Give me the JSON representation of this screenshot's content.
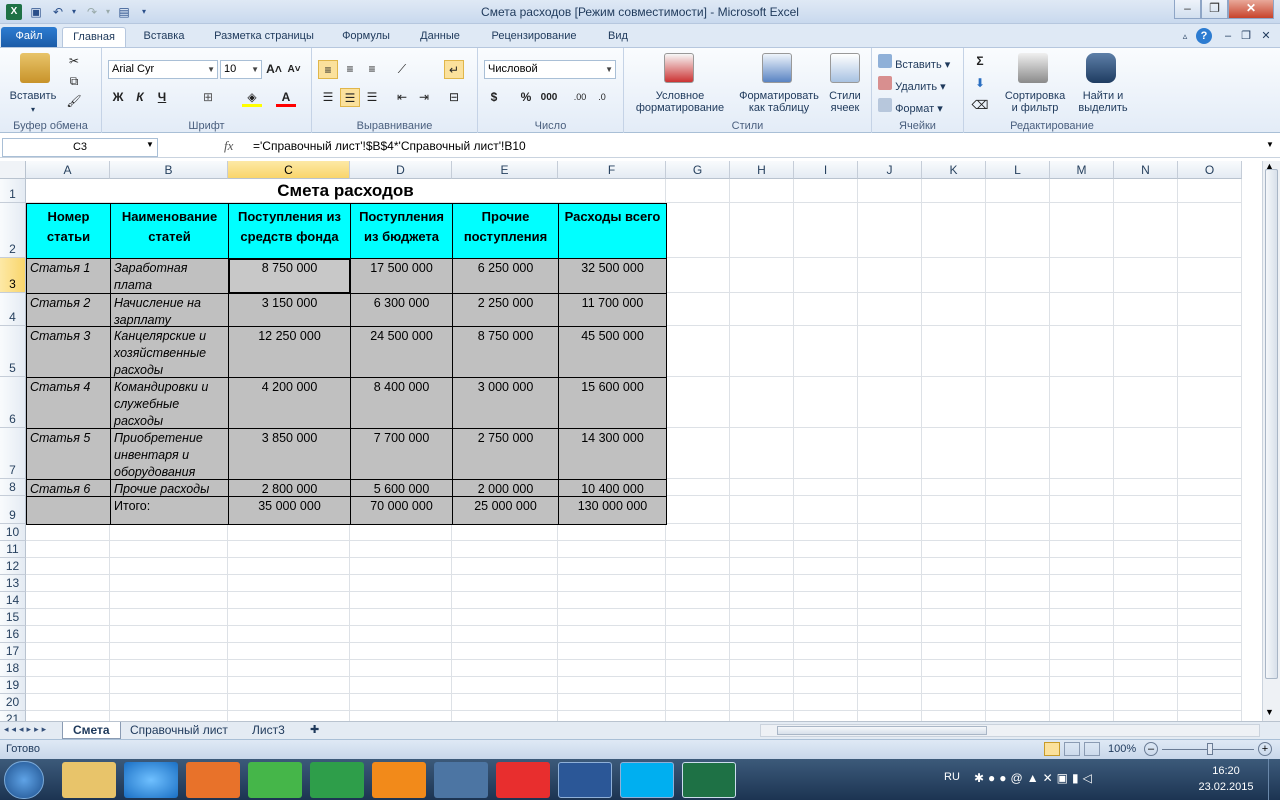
{
  "window": {
    "title": "Смета расходов  [Режим совместимости]  -  Microsoft Excel"
  },
  "tabs": [
    "Файл",
    "Главная",
    "Вставка",
    "Разметка страницы",
    "Формулы",
    "Данные",
    "Рецензирование",
    "Вид"
  ],
  "ribbon": {
    "groups": {
      "clipboard": "Буфер обмена",
      "font": "Шрифт",
      "alignment": "Выравнивание",
      "number": "Число",
      "styles": "Стили",
      "cells": "Ячейки",
      "editing": "Редактирование"
    },
    "paste_label": "Вставить",
    "font_name": "Arial Cyr",
    "font_size": "10",
    "bold": "Ж",
    "italic": "К",
    "underline": "Ч",
    "number_format": "Числовой",
    "currency": "$",
    "percent": "%",
    "thousands": "000",
    "cond_format_1": "Условное",
    "cond_format_2": "форматирование",
    "format_table_1": "Форматировать",
    "format_table_2": "как таблицу",
    "cell_styles_1": "Стили",
    "cell_styles_2": "ячеек",
    "insert": "Вставить",
    "delete": "Удалить",
    "format": "Формат",
    "sort_1": "Сортировка",
    "sort_2": "и фильтр",
    "find_1": "Найти и",
    "find_2": "выделить",
    "sigma": "Σ"
  },
  "formula_bar": {
    "name_box": "C3",
    "fx": "fx",
    "formula": "='Справочный лист'!$B$4*'Справочный лист'!B10"
  },
  "columns": [
    "A",
    "B",
    "C",
    "D",
    "E",
    "F",
    "G",
    "H",
    "I",
    "J",
    "K",
    "L",
    "M",
    "N",
    "O"
  ],
  "rows": [
    "1",
    "2",
    "3",
    "4",
    "5",
    "6",
    "7",
    "8",
    "9",
    "10",
    "11",
    "12",
    "13",
    "14",
    "15",
    "16",
    "17",
    "18",
    "19",
    "20",
    "21"
  ],
  "sheet": {
    "title": "Смета расходов",
    "headers": [
      "Номер статьи",
      "Наименование статей",
      "Поступления из средств фонда",
      "Поступления из бюджета",
      "Прочие поступления",
      "Расходы всего"
    ],
    "data": [
      [
        "Статья 1",
        "Заработная плата",
        "8 750 000",
        "17 500 000",
        "6 250 000",
        "32 500 000"
      ],
      [
        "Статья 2",
        "Начисление на зарплату",
        "3 150 000",
        "6 300 000",
        "2 250 000",
        "11 700 000"
      ],
      [
        "Статья 3",
        "Канцелярские и хозяйственные расходы",
        "12 250 000",
        "24 500 000",
        "8 750 000",
        "45 500 000"
      ],
      [
        "Статья 4",
        "Командировки и служебные расходы",
        "4 200 000",
        "8 400 000",
        "3 000 000",
        "15 600 000"
      ],
      [
        "Статья 5",
        "Приобретение инвентаря и оборудования",
        "3 850 000",
        "7 700 000",
        "2 750 000",
        "14 300 000"
      ],
      [
        "Статья 6",
        "Прочие расходы",
        "2 800 000",
        "5 600 000",
        "2 000 000",
        "10 400 000"
      ],
      [
        "",
        "Итого:",
        "35 000 000",
        "70 000 000",
        "25 000 000",
        "130 000 000"
      ]
    ]
  },
  "sheet_tabs": [
    "Смета",
    "Справочный лист",
    "Лист3"
  ],
  "status": {
    "ready": "Готово",
    "zoom": "100%"
  },
  "taskbar": {
    "lang": "RU",
    "time": "16:20",
    "date": "23.02.2015"
  },
  "colors": {
    "header_fill": "#00ffff",
    "data_fill": "#c0c0c0",
    "selection": "#f9d56b",
    "accent": "#1c5ca8"
  }
}
